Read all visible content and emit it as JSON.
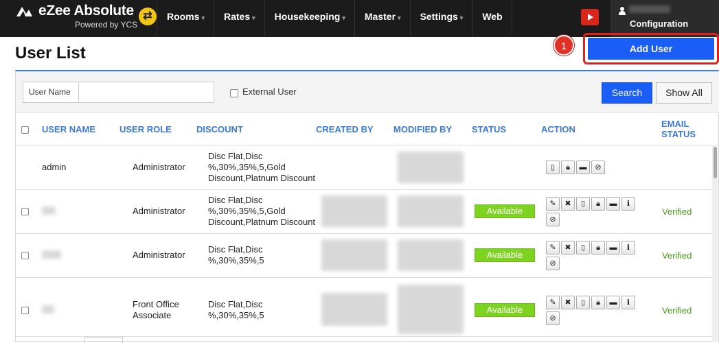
{
  "topbar": {
    "brand_name": "eZee Absolute",
    "brand_sub": "Powered by YCS",
    "nav": [
      "Rooms",
      "Rates",
      "Housekeeping",
      "Master",
      "Settings",
      "Web"
    ],
    "nav_has_caret": [
      true,
      true,
      true,
      true,
      true,
      false
    ],
    "user_label": "Configuration"
  },
  "page": {
    "title": "User List",
    "step_number": "1",
    "add_user_label": "Add User"
  },
  "filter": {
    "user_name_label": "User Name",
    "user_name_value": "",
    "external_user_label": "External User",
    "search_label": "Search",
    "show_all_label": "Show All"
  },
  "table": {
    "headers": {
      "user_name": "USER NAME",
      "user_role": "USER ROLE",
      "discount": "DISCOUNT",
      "created_by": "CREATED BY",
      "modified_by": "MODIFIED BY",
      "status": "STATUS",
      "action": "ACTION",
      "email_status_1": "EMAIL",
      "email_status_2": "STATUS"
    },
    "rows": [
      {
        "user_name": "admin",
        "role": "Administrator",
        "discount": [
          "Disc Flat,Disc",
          "%,30%,35%,5,Gold",
          "Discount,Platnum Discount"
        ],
        "status": "",
        "email_status": ""
      },
      {
        "user_name": "",
        "role": "Administrator",
        "discount": [
          "Disc Flat,Disc",
          "%,30%,35%,5,Gold",
          "Discount,Platnum Discount"
        ],
        "status": "Available",
        "email_status": "Verified"
      },
      {
        "user_name": "",
        "role": "Administrator",
        "discount": [
          "Disc Flat,Disc",
          "%,30%,35%,5"
        ],
        "status": "Available",
        "email_status": "Verified"
      },
      {
        "user_name": "",
        "role": [
          "Front Office",
          "Associate"
        ],
        "discount": [
          "Disc Flat,Disc",
          "%,30%,35%,5"
        ],
        "status": "Available",
        "email_status": "Verified"
      }
    ],
    "icons": {
      "edit": "pencil-icon",
      "delete": "close-icon",
      "mobile": "mobile-icon",
      "lock": "lock-icon",
      "message": "message-icon",
      "info": "info-icon",
      "no_mobile": "no-mobile-icon"
    }
  },
  "colors": {
    "topbar_bg": "#1b1b1b",
    "accent_blue": "#1a5ef5",
    "header_blue": "#3b7ad8",
    "status_green": "#7ed321",
    "verified_green": "#4c9a1b",
    "highlight_red": "#e3211a"
  }
}
